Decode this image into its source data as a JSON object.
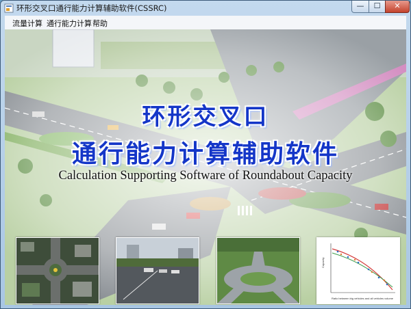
{
  "window": {
    "title": "环形交叉口通行能力计算辅助软件(CSSRC)",
    "controls": {
      "minimize": "—",
      "maximize": "☐",
      "close": "✕"
    }
  },
  "menu": {
    "items": [
      {
        "label": "流量计算"
      },
      {
        "label": "通行能力计算"
      },
      {
        "label": "帮助"
      }
    ]
  },
  "banner": {
    "title_line1": "环形交叉口",
    "title_line2": "通行能力计算辅助软件",
    "subtitle": "Calculation Supporting Software of Roundabout Capacity"
  },
  "thumbnails": [
    {
      "name": "aerial-roundabout"
    },
    {
      "name": "street-photo"
    },
    {
      "name": "roundabout-render"
    },
    {
      "name": "capacity-chart",
      "xlabel": "Ratio between big vehicles and all vehicles volume",
      "ylabel": "Capacity"
    }
  ],
  "colors": {
    "title_blue": "#1436c8",
    "road": "#8c9196",
    "grass": "#9ec57a"
  }
}
